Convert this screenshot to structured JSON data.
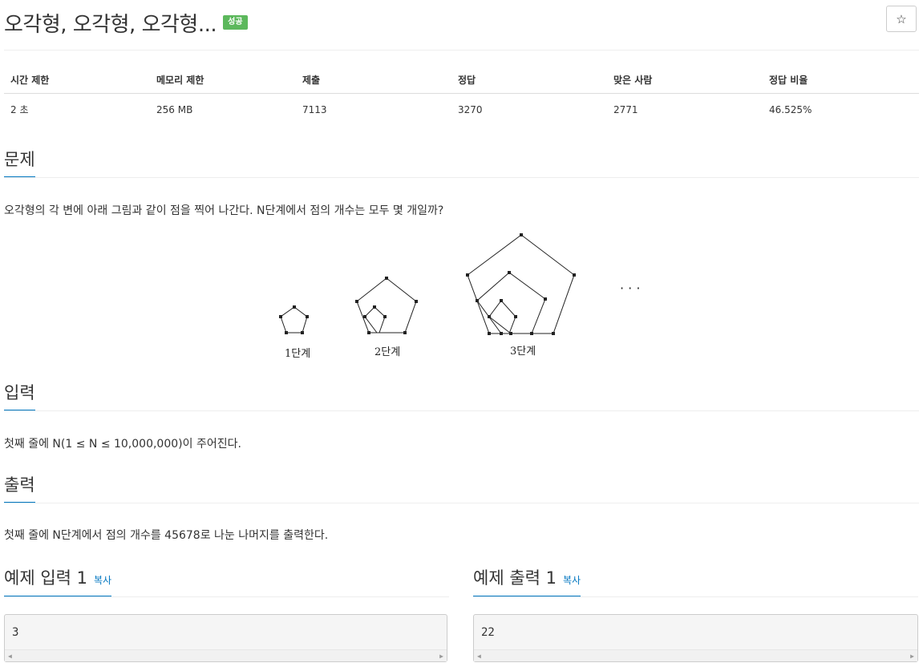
{
  "header": {
    "title": "오각형, 오각형, 오각형...",
    "badge": "성공",
    "star_icon": "☆"
  },
  "info_table": {
    "headers": [
      "시간 제한",
      "메모리 제한",
      "제출",
      "정답",
      "맞은 사람",
      "정답 비율"
    ],
    "values": [
      "2 초",
      "256 MB",
      "7113",
      "3270",
      "2771",
      "46.525%"
    ]
  },
  "sections": {
    "problem": {
      "title": "문제",
      "text": "오각형의 각 변에 아래 그림과 같이 점을 찍어 나간다. N단계에서 점의 개수는 모두 몇 개일까?"
    },
    "input": {
      "title": "입력",
      "text": "첫째 줄에 N(1 ≤ N ≤ 10,000,000)이 주어진다."
    },
    "output": {
      "title": "출력",
      "text": "첫째 줄에 N단계에서 점의 개수를 45678로 나눈 나머지를 출력한다."
    }
  },
  "figure": {
    "labels": [
      "1단계",
      "2단계",
      "3단계"
    ],
    "ellipsis": "· · ·"
  },
  "examples": {
    "input": {
      "title": "예제 입력 1",
      "copy": "복사",
      "value": "3"
    },
    "output": {
      "title": "예제 출력 1",
      "copy": "복사",
      "value": "22"
    }
  },
  "colors": {
    "accent": "#0076c0",
    "badge": "#5cb85c"
  }
}
